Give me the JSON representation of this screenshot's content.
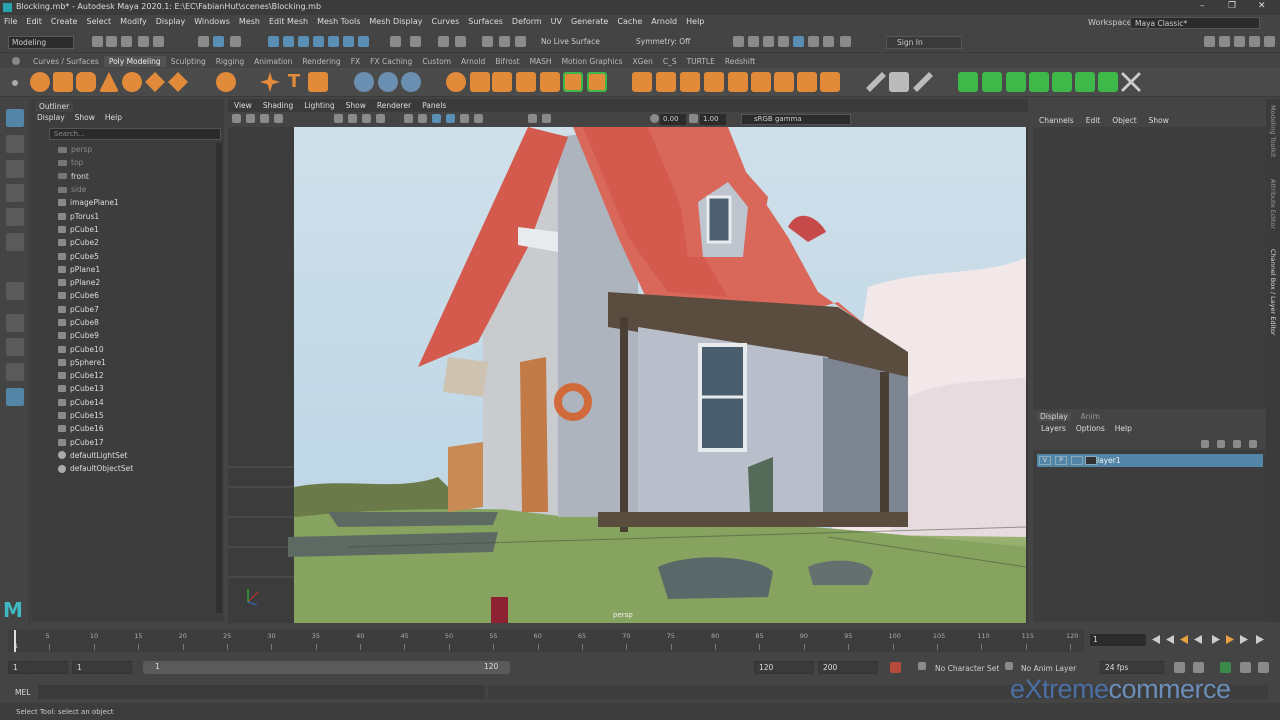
{
  "window": {
    "title": "Blocking.mb* - Autodesk Maya 2020.1: E:\\EC\\FabianHut\\scenes\\Blocking.mb",
    "controls": [
      "–",
      "❐",
      "✕"
    ]
  },
  "menubar": {
    "items": [
      "File",
      "Edit",
      "Create",
      "Select",
      "Modify",
      "Display",
      "Windows",
      "Mesh",
      "Edit Mesh",
      "Mesh Tools",
      "Mesh Display",
      "Curves",
      "Surfaces",
      "Deform",
      "UV",
      "Generate",
      "Cache",
      "Arnold",
      "Help"
    ],
    "workspace_label": "Workspace :",
    "workspace_value": "Maya Classic*"
  },
  "statusline": {
    "mode": "Modeling",
    "live_surface": "No Live Surface",
    "symmetry": "Symmetry: Off",
    "sign_in": "Sign In"
  },
  "shelf": {
    "tabs": [
      "Curves / Surfaces",
      "Poly Modeling",
      "Sculpting",
      "Rigging",
      "Animation",
      "Rendering",
      "FX",
      "FX Caching",
      "Custom",
      "Arnold",
      "Bifrost",
      "MASH",
      "Motion Graphics",
      "XGen",
      "C_S",
      "TURTLE",
      "Redshift"
    ],
    "active_tab": "Poly Modeling"
  },
  "outliner": {
    "tab": "Outliner",
    "menu": [
      "Display",
      "Show",
      "Help"
    ],
    "search_placeholder": "Search...",
    "items": [
      {
        "label": "persp",
        "type": "cam",
        "dim": true
      },
      {
        "label": "top",
        "type": "cam",
        "dim": true
      },
      {
        "label": "front",
        "type": "cam",
        "dim": false
      },
      {
        "label": "side",
        "type": "cam",
        "dim": true
      },
      {
        "label": "imagePlane1",
        "type": "mesh",
        "dim": false
      },
      {
        "label": "pTorus1",
        "type": "mesh",
        "dim": false
      },
      {
        "label": "pCube1",
        "type": "mesh",
        "dim": false
      },
      {
        "label": "pCube2",
        "type": "mesh",
        "dim": false
      },
      {
        "label": "pCube5",
        "type": "mesh",
        "dim": false
      },
      {
        "label": "pPlane1",
        "type": "mesh",
        "dim": false
      },
      {
        "label": "pPlane2",
        "type": "mesh",
        "dim": false
      },
      {
        "label": "pCube6",
        "type": "mesh",
        "dim": false
      },
      {
        "label": "pCube7",
        "type": "mesh",
        "dim": false
      },
      {
        "label": "pCube8",
        "type": "mesh",
        "dim": false
      },
      {
        "label": "pCube9",
        "type": "mesh",
        "dim": false
      },
      {
        "label": "pCube10",
        "type": "mesh",
        "dim": false
      },
      {
        "label": "pSphere1",
        "type": "mesh",
        "dim": false
      },
      {
        "label": "pCube12",
        "type": "mesh",
        "dim": false
      },
      {
        "label": "pCube13",
        "type": "mesh",
        "dim": false
      },
      {
        "label": "pCube14",
        "type": "mesh",
        "dim": false
      },
      {
        "label": "pCube15",
        "type": "mesh",
        "dim": false
      },
      {
        "label": "pCube16",
        "type": "mesh",
        "dim": false
      },
      {
        "label": "pCube17",
        "type": "mesh",
        "dim": false
      },
      {
        "label": "defaultLightSet",
        "type": "set",
        "dim": false
      },
      {
        "label": "defaultObjectSet",
        "type": "set",
        "dim": false
      }
    ]
  },
  "viewport": {
    "menu": [
      "View",
      "Shading",
      "Lighting",
      "Show",
      "Renderer",
      "Panels"
    ],
    "exposure": "0.00",
    "gamma": "1.00",
    "color_space": "sRGB gamma",
    "camera_label": "persp"
  },
  "channelbox": {
    "menu": [
      "Channels",
      "Edit",
      "Object",
      "Show"
    ]
  },
  "layereditor": {
    "tabs": [
      "Display",
      "Anim"
    ],
    "menu": [
      "Layers",
      "Options",
      "Help"
    ],
    "layer_name": "layer1",
    "layer_flags": [
      "V",
      "P",
      ""
    ]
  },
  "right_sidebar": {
    "labels": [
      "Modeling Toolkit",
      "Attribute Editor",
      "Channel Box / Layer Editor"
    ]
  },
  "timeslider": {
    "ticks": [
      "5",
      "10",
      "15",
      "20",
      "25",
      "30",
      "35",
      "40",
      "45",
      "50",
      "55",
      "60",
      "65",
      "70",
      "75",
      "80",
      "85",
      "90",
      "95",
      "100",
      "105",
      "110",
      "115",
      "120"
    ],
    "start_label": "1",
    "current_frame": "1"
  },
  "rangeslider": {
    "start": "1",
    "playback_start": "1",
    "bar_start": "1",
    "bar_end": "120",
    "playback_end": "120",
    "end": "200",
    "character_set": "No Character Set",
    "anim_layer": "No Anim Layer",
    "fps": "24 fps"
  },
  "cmdline": {
    "mel_label": "MEL",
    "watermark_a": "eXtreme",
    "watermark_b": "commerce"
  },
  "helpline": {
    "text": "Select Tool: select an object"
  }
}
